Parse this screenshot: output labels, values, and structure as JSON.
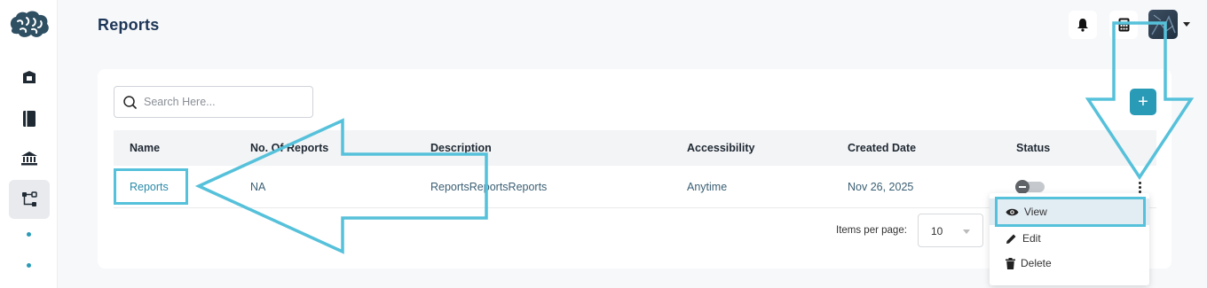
{
  "header": {
    "title": "Reports"
  },
  "sidebar": {
    "logo_icon": "brain-logo-icon",
    "items": [
      {
        "icon": "box-icon",
        "active": false
      },
      {
        "icon": "book-icon",
        "active": false
      },
      {
        "icon": "bank-icon",
        "active": false
      },
      {
        "icon": "flow-icon",
        "active": true
      }
    ]
  },
  "search": {
    "placeholder": "Search Here..."
  },
  "add_button": {
    "label": "+"
  },
  "table": {
    "columns": [
      "Name",
      "No. Of Reports",
      "Description",
      "Accessibility",
      "Created Date",
      "Status"
    ],
    "rows": [
      {
        "name": "Reports",
        "count": "NA",
        "description": "ReportsReportsReports",
        "accessibility": "Anytime",
        "created": "Nov 26, 2025",
        "status": "off"
      }
    ]
  },
  "pagination": {
    "label": "Items per page:",
    "value": "10"
  },
  "action_menu": {
    "items": [
      "View",
      "Edit",
      "Delete"
    ]
  },
  "colors": {
    "accent": "#2a9bb7",
    "annotation": "#56c1da",
    "title": "#1d3557"
  }
}
